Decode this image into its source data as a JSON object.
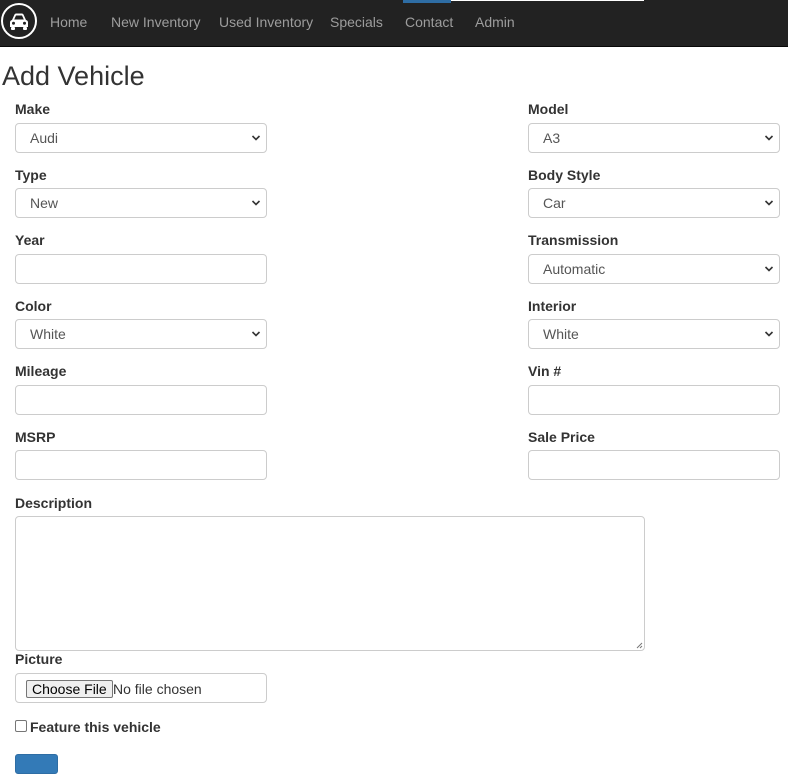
{
  "nav": {
    "brand_icon": "car-icon",
    "items": [
      {
        "label": "Home"
      },
      {
        "label": "New Inventory"
      },
      {
        "label": "Used Inventory"
      },
      {
        "label": "Specials"
      },
      {
        "label": "Contact"
      },
      {
        "label": "Admin"
      }
    ],
    "active": "Contact"
  },
  "page": {
    "title": "Add Vehicle"
  },
  "form": {
    "make": {
      "label": "Make",
      "value": "Audi"
    },
    "model": {
      "label": "Model",
      "value": "A3"
    },
    "type": {
      "label": "Type",
      "value": "New"
    },
    "body_style": {
      "label": "Body Style",
      "value": "Car"
    },
    "year": {
      "label": "Year",
      "value": ""
    },
    "transmission": {
      "label": "Transmission",
      "value": "Automatic"
    },
    "color": {
      "label": "Color",
      "value": "White"
    },
    "interior": {
      "label": "Interior",
      "value": "White"
    },
    "mileage": {
      "label": "Mileage",
      "value": ""
    },
    "vin": {
      "label": "Vin #",
      "value": ""
    },
    "msrp": {
      "label": "MSRP",
      "value": ""
    },
    "sale_price": {
      "label": "Sale Price",
      "value": ""
    },
    "description": {
      "label": "Description",
      "value": ""
    },
    "picture": {
      "label": "Picture",
      "button_label": "Choose File",
      "status": "No file chosen"
    },
    "feature": {
      "label": "Feature this vehicle",
      "checked": false
    }
  },
  "colors": {
    "navbar": "#222222",
    "nav_text": "#9d9d9d",
    "primary": "#337ab7"
  }
}
